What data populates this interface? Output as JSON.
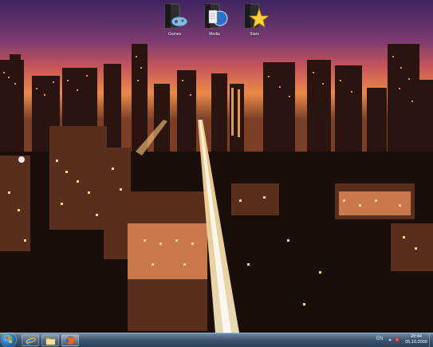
{
  "desktop": {
    "icons": [
      {
        "label": "Games",
        "icon": "gamepad-folder-icon"
      },
      {
        "label": "Media",
        "icon": "media-folder-icon"
      },
      {
        "label": "Stars",
        "icon": "star-folder-icon"
      }
    ]
  },
  "taskbar": {
    "start": "start-orb-icon",
    "pinned": [
      "internet-explorer-icon",
      "folder-icon",
      "firefox-icon"
    ],
    "language": "EN",
    "time": "20:44",
    "date": "05.10.2009"
  },
  "colors": {
    "taskbar": "#3f5873",
    "accent": "#2a7bd0"
  }
}
